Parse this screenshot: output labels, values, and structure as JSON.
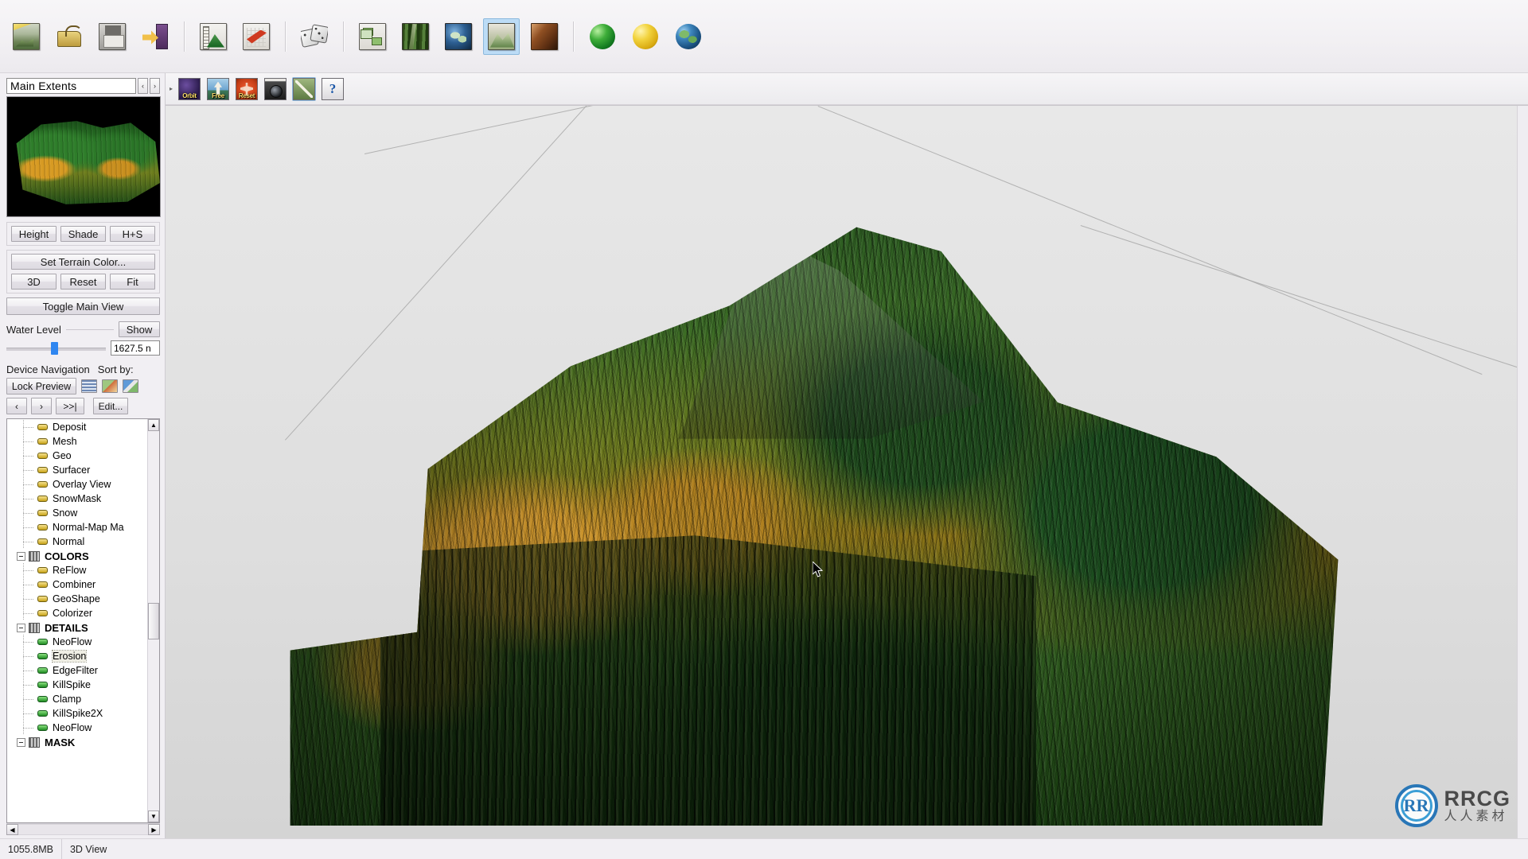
{
  "app": {
    "status_memory": "1055.8MB",
    "status_mode": "3D View"
  },
  "main_toolbar": {
    "buttons": [
      {
        "name": "new-terrain",
        "label": "New Terrain",
        "icon": "new-terrain-icon",
        "active": false
      },
      {
        "name": "open",
        "label": "Open",
        "icon": "open-folder-icon",
        "active": false
      },
      {
        "name": "save",
        "label": "Save",
        "icon": "floppy-save-icon",
        "active": false
      },
      {
        "name": "save-as",
        "label": "Save As",
        "icon": "save-as-icon",
        "active": false
      },
      {
        "name": "height-field",
        "label": "Height Field",
        "icon": "ruler-mountain-icon",
        "active": false
      },
      {
        "name": "edit-terrain",
        "label": "Edit Terrain",
        "icon": "pencil-edit-icon",
        "active": false
      },
      {
        "name": "randomize",
        "label": "Randomize",
        "icon": "dice-icon",
        "active": false
      },
      {
        "name": "device-network",
        "label": "Device Network",
        "icon": "node-network-icon",
        "active": false
      },
      {
        "name": "texture-view",
        "label": "Texture View",
        "icon": "texture-icon",
        "active": false
      },
      {
        "name": "world-view",
        "label": "World View",
        "icon": "globe-icon",
        "active": false
      },
      {
        "name": "terrain-view",
        "label": "3D Terrain View",
        "icon": "terrain-preview-icon",
        "active": true
      },
      {
        "name": "rock-view",
        "label": "Rock / Material View",
        "icon": "rock-texture-icon",
        "active": false
      },
      {
        "name": "render-green",
        "label": "Render Green",
        "icon": "green-sphere-icon",
        "active": false
      },
      {
        "name": "render-yellow",
        "label": "Render Yellow",
        "icon": "yellow-sphere-icon",
        "active": false
      },
      {
        "name": "render-earth",
        "label": "Render Earth",
        "icon": "earth-sphere-icon",
        "active": false
      }
    ]
  },
  "view_toolbar": {
    "buttons": [
      {
        "name": "orbit",
        "label": "Orbit",
        "icon": "orbit-icon",
        "active": false
      },
      {
        "name": "free",
        "label": "Free",
        "icon": "free-move-icon",
        "active": false
      },
      {
        "name": "reset",
        "label": "Reset",
        "icon": "reset-icon",
        "active": false
      },
      {
        "name": "camera",
        "label": "",
        "icon": "camera-icon",
        "active": false
      },
      {
        "name": "wireframe",
        "label": "",
        "icon": "diagonal-line-icon",
        "active": true
      },
      {
        "name": "help",
        "label": "",
        "icon": "question-mark-icon",
        "active": false
      }
    ]
  },
  "left_panel": {
    "extents": {
      "value": "Main Extents",
      "prev_label": "‹",
      "next_label": "›"
    },
    "preview_name": "terrain-thumbnail",
    "display_modes": [
      {
        "name": "height",
        "label": "Height"
      },
      {
        "name": "shade",
        "label": "Shade"
      },
      {
        "name": "h-plus-s",
        "label": "H+S"
      }
    ],
    "set_terrain_color_label": "Set Terrain Color...",
    "view_buttons": [
      {
        "name": "3d",
        "label": "3D"
      },
      {
        "name": "reset",
        "label": "Reset"
      },
      {
        "name": "fit",
        "label": "Fit"
      }
    ],
    "toggle_main_view_label": "Toggle Main View",
    "water_level": {
      "label": "Water Level",
      "show_label": "Show",
      "value": "1627.5 n",
      "slider_percent": 45
    },
    "device_navigation": {
      "label": "Device Navigation",
      "sort_by_label": "Sort by:",
      "lock_preview_label": "Lock Preview",
      "sort_icons": [
        {
          "name": "sort-list-icon"
        },
        {
          "name": "sort-thumbnail-icon"
        },
        {
          "name": "sort-color-icon"
        }
      ],
      "nav_buttons": [
        {
          "name": "prev",
          "label": "‹"
        },
        {
          "name": "next",
          "label": "›"
        },
        {
          "name": "last",
          "label": ">>|"
        }
      ],
      "edit_label": "Edit..."
    },
    "tree": [
      {
        "type": "leaf",
        "label": "Deposit",
        "dot": "yellow",
        "selected": false
      },
      {
        "type": "leaf",
        "label": "Mesh",
        "dot": "yellow",
        "selected": false
      },
      {
        "type": "leaf",
        "label": "Geo",
        "dot": "yellow",
        "selected": false
      },
      {
        "type": "leaf",
        "label": "Surfacer",
        "dot": "yellow",
        "selected": false
      },
      {
        "type": "leaf",
        "label": "Overlay View",
        "dot": "yellow",
        "selected": false
      },
      {
        "type": "leaf",
        "label": "SnowMask",
        "dot": "yellow",
        "selected": false
      },
      {
        "type": "leaf",
        "label": "Snow",
        "dot": "yellow",
        "selected": false
      },
      {
        "type": "leaf",
        "label": "Normal-Map Ma",
        "dot": "yellow",
        "selected": false
      },
      {
        "type": "leaf",
        "label": "Normal",
        "dot": "yellow",
        "selected": false
      },
      {
        "type": "group",
        "label": "COLORS"
      },
      {
        "type": "leaf",
        "label": "ReFlow",
        "dot": "yellow",
        "selected": false
      },
      {
        "type": "leaf",
        "label": "Combiner",
        "dot": "yellow",
        "selected": false
      },
      {
        "type": "leaf",
        "label": "GeoShape",
        "dot": "yellow",
        "selected": false
      },
      {
        "type": "leaf",
        "label": "Colorizer",
        "dot": "yellow",
        "selected": false
      },
      {
        "type": "group",
        "label": "DETAILS"
      },
      {
        "type": "leaf",
        "label": "NeoFlow",
        "dot": "green",
        "selected": false
      },
      {
        "type": "leaf",
        "label": "Erosion",
        "dot": "green",
        "selected": true
      },
      {
        "type": "leaf",
        "label": "EdgeFilter",
        "dot": "green",
        "selected": false
      },
      {
        "type": "leaf",
        "label": "KillSpike",
        "dot": "green",
        "selected": false
      },
      {
        "type": "leaf",
        "label": "Clamp",
        "dot": "green",
        "selected": false
      },
      {
        "type": "leaf",
        "label": "KillSpike2X",
        "dot": "green",
        "selected": false
      },
      {
        "type": "leaf",
        "label": "NeoFlow",
        "dot": "green",
        "selected": false
      },
      {
        "type": "group",
        "label": "MASK"
      }
    ]
  },
  "watermark": {
    "mark": "RR",
    "main": "RRCG",
    "sub": "人人素材"
  },
  "colors": {
    "accent": "#bcdcf6",
    "slider": "#2f86f0",
    "terrain_green": "#2e7d2a",
    "terrain_gold": "#c9922a",
    "panel_bg": "#f1eff3"
  }
}
